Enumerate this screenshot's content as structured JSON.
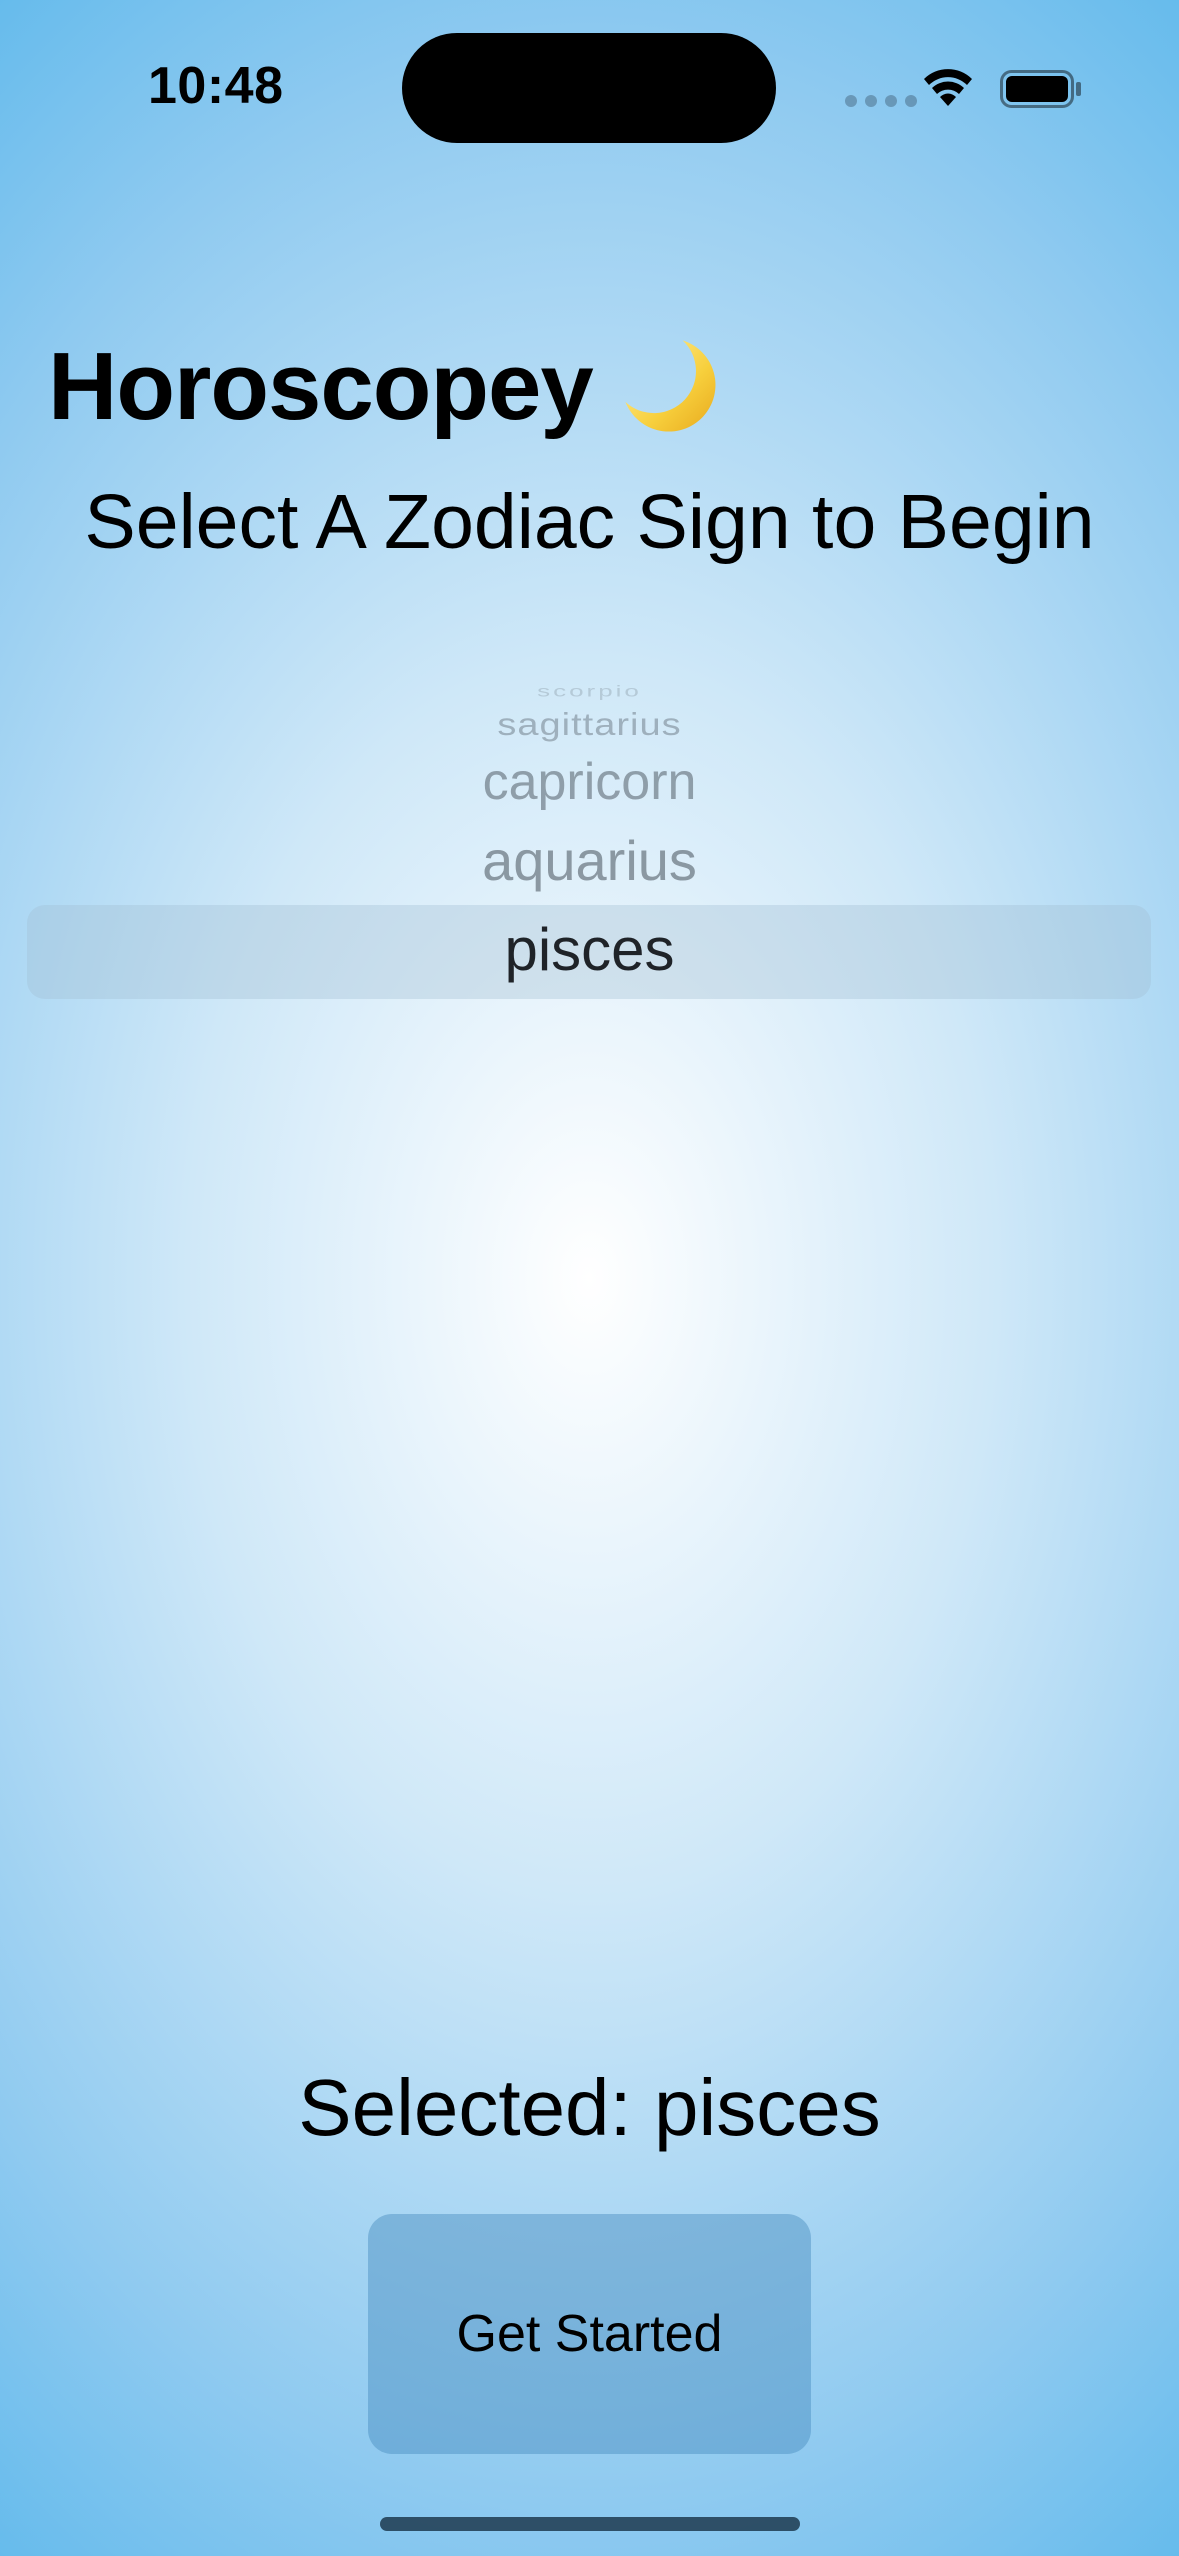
{
  "status_bar": {
    "time": "10:48",
    "icons": [
      "signal-dots-icon",
      "wifi-icon",
      "battery-icon"
    ]
  },
  "header": {
    "title": "Horoscopey",
    "title_icon": "crescent-moon-icon",
    "subtitle": "Select A Zodiac Sign to Begin"
  },
  "picker": {
    "items": [
      "scorpio",
      "sagittarius",
      "capricorn",
      "aquarius",
      "pisces"
    ],
    "selected": "pisces"
  },
  "selection": {
    "text": "Selected: pisces"
  },
  "actions": {
    "get_started_label": "Get Started"
  },
  "colors": {
    "background_center": "#ffffff",
    "background_edge": "#4fb3ea",
    "button_fill": "#6ea9d0"
  }
}
